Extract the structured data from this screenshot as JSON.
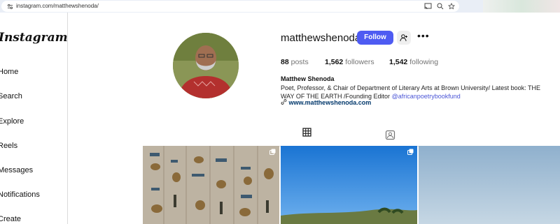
{
  "browser": {
    "url": "instagram.com/matthewshenoda/"
  },
  "sidebar": {
    "logo": "Instagram",
    "items": [
      {
        "label": "Home"
      },
      {
        "label": "Search"
      },
      {
        "label": "Explore"
      },
      {
        "label": "Reels"
      },
      {
        "label": "Messages"
      },
      {
        "label": "Notifications"
      },
      {
        "label": "Create"
      }
    ]
  },
  "profile": {
    "username": "matthewshenoda",
    "follow_label": "Follow",
    "stats": {
      "posts_count": "88",
      "posts_label": "posts",
      "followers_count": "1,562",
      "followers_label": "followers",
      "following_count": "1,542",
      "following_label": "following"
    },
    "full_name": "Matthew Shenoda",
    "bio_text": "Poet, Professor, & Chair of Department of Literary Arts at Brown University/ Latest book: THE WAY OF THE EARTH /Founding Editor ",
    "bio_mention": "@africanpoetrybookfund",
    "website": "www.matthewshenoda.com"
  },
  "icons": [
    "tune-icon",
    "cast-icon",
    "zoom-icon",
    "star-icon",
    "add-user-icon",
    "more-icon",
    "grid-icon",
    "tagged-icon",
    "link-icon",
    "multiple-posts-icon"
  ],
  "colors": {
    "follow_button": "#4e5bf2",
    "mention": "#4a55d6",
    "link": "#00376b"
  }
}
